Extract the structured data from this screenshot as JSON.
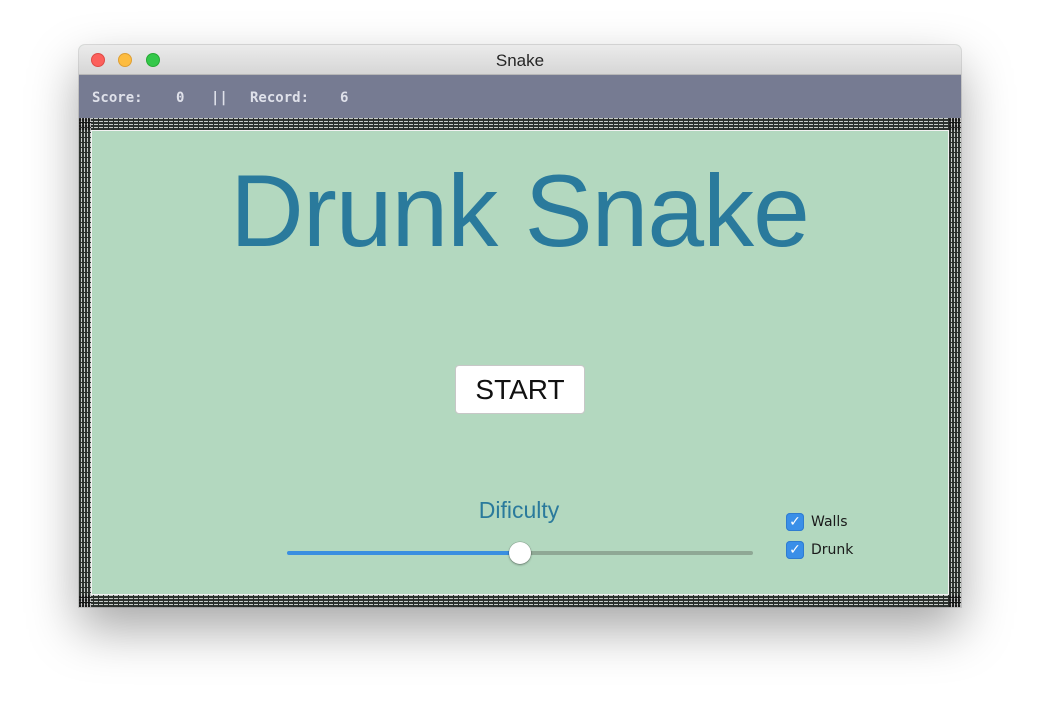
{
  "window": {
    "title": "Snake"
  },
  "scorebar": {
    "score_label": "Score:",
    "score_value": "0",
    "separator": "||",
    "record_label": "Record:",
    "record_value": "6"
  },
  "game": {
    "headline": "Drunk Snake",
    "start_label": "START",
    "difficulty_label": "Dificulty",
    "difficulty_value": 0.5,
    "options": [
      {
        "label": "Walls",
        "checked": true,
        "check_glyph": "✓"
      },
      {
        "label": "Drunk",
        "checked": true,
        "check_glyph": "✓"
      }
    ]
  },
  "colors": {
    "field": "#b3d8bf",
    "headline": "#2a7a9c",
    "scorebar": "#767b92",
    "slider_active": "#3a8fe0",
    "checkbox": "#3a8fe8"
  },
  "icons": {
    "close": "close-icon",
    "minimize": "minimize-icon",
    "maximize": "maximize-icon",
    "checkmark": "checkmark-icon"
  }
}
